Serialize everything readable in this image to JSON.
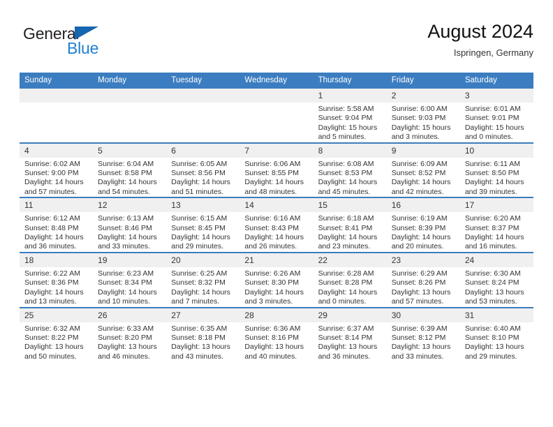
{
  "brand": {
    "name_part1": "General",
    "name_part2": "Blue",
    "triangle_color": "#1565b0",
    "blue_color": "#1f7fd0"
  },
  "header": {
    "title": "August 2024",
    "subtitle": "Ispringen, Germany"
  },
  "theme": {
    "header_bg": "#3b7dc0",
    "daynum_bg": "#f0f0f0",
    "row_divider": "#3b7dc0",
    "text": "#333333"
  },
  "weekdays": [
    "Sunday",
    "Monday",
    "Tuesday",
    "Wednesday",
    "Thursday",
    "Friday",
    "Saturday"
  ],
  "weeks": [
    [
      {
        "day": "",
        "sunrise": "",
        "sunset": "",
        "daylight1": "",
        "daylight2": ""
      },
      {
        "day": "",
        "sunrise": "",
        "sunset": "",
        "daylight1": "",
        "daylight2": ""
      },
      {
        "day": "",
        "sunrise": "",
        "sunset": "",
        "daylight1": "",
        "daylight2": ""
      },
      {
        "day": "",
        "sunrise": "",
        "sunset": "",
        "daylight1": "",
        "daylight2": ""
      },
      {
        "day": "1",
        "sunrise": "Sunrise: 5:58 AM",
        "sunset": "Sunset: 9:04 PM",
        "daylight1": "Daylight: 15 hours",
        "daylight2": "and 5 minutes."
      },
      {
        "day": "2",
        "sunrise": "Sunrise: 6:00 AM",
        "sunset": "Sunset: 9:03 PM",
        "daylight1": "Daylight: 15 hours",
        "daylight2": "and 3 minutes."
      },
      {
        "day": "3",
        "sunrise": "Sunrise: 6:01 AM",
        "sunset": "Sunset: 9:01 PM",
        "daylight1": "Daylight: 15 hours",
        "daylight2": "and 0 minutes."
      }
    ],
    [
      {
        "day": "4",
        "sunrise": "Sunrise: 6:02 AM",
        "sunset": "Sunset: 9:00 PM",
        "daylight1": "Daylight: 14 hours",
        "daylight2": "and 57 minutes."
      },
      {
        "day": "5",
        "sunrise": "Sunrise: 6:04 AM",
        "sunset": "Sunset: 8:58 PM",
        "daylight1": "Daylight: 14 hours",
        "daylight2": "and 54 minutes."
      },
      {
        "day": "6",
        "sunrise": "Sunrise: 6:05 AM",
        "sunset": "Sunset: 8:56 PM",
        "daylight1": "Daylight: 14 hours",
        "daylight2": "and 51 minutes."
      },
      {
        "day": "7",
        "sunrise": "Sunrise: 6:06 AM",
        "sunset": "Sunset: 8:55 PM",
        "daylight1": "Daylight: 14 hours",
        "daylight2": "and 48 minutes."
      },
      {
        "day": "8",
        "sunrise": "Sunrise: 6:08 AM",
        "sunset": "Sunset: 8:53 PM",
        "daylight1": "Daylight: 14 hours",
        "daylight2": "and 45 minutes."
      },
      {
        "day": "9",
        "sunrise": "Sunrise: 6:09 AM",
        "sunset": "Sunset: 8:52 PM",
        "daylight1": "Daylight: 14 hours",
        "daylight2": "and 42 minutes."
      },
      {
        "day": "10",
        "sunrise": "Sunrise: 6:11 AM",
        "sunset": "Sunset: 8:50 PM",
        "daylight1": "Daylight: 14 hours",
        "daylight2": "and 39 minutes."
      }
    ],
    [
      {
        "day": "11",
        "sunrise": "Sunrise: 6:12 AM",
        "sunset": "Sunset: 8:48 PM",
        "daylight1": "Daylight: 14 hours",
        "daylight2": "and 36 minutes."
      },
      {
        "day": "12",
        "sunrise": "Sunrise: 6:13 AM",
        "sunset": "Sunset: 8:46 PM",
        "daylight1": "Daylight: 14 hours",
        "daylight2": "and 33 minutes."
      },
      {
        "day": "13",
        "sunrise": "Sunrise: 6:15 AM",
        "sunset": "Sunset: 8:45 PM",
        "daylight1": "Daylight: 14 hours",
        "daylight2": "and 29 minutes."
      },
      {
        "day": "14",
        "sunrise": "Sunrise: 6:16 AM",
        "sunset": "Sunset: 8:43 PM",
        "daylight1": "Daylight: 14 hours",
        "daylight2": "and 26 minutes."
      },
      {
        "day": "15",
        "sunrise": "Sunrise: 6:18 AM",
        "sunset": "Sunset: 8:41 PM",
        "daylight1": "Daylight: 14 hours",
        "daylight2": "and 23 minutes."
      },
      {
        "day": "16",
        "sunrise": "Sunrise: 6:19 AM",
        "sunset": "Sunset: 8:39 PM",
        "daylight1": "Daylight: 14 hours",
        "daylight2": "and 20 minutes."
      },
      {
        "day": "17",
        "sunrise": "Sunrise: 6:20 AM",
        "sunset": "Sunset: 8:37 PM",
        "daylight1": "Daylight: 14 hours",
        "daylight2": "and 16 minutes."
      }
    ],
    [
      {
        "day": "18",
        "sunrise": "Sunrise: 6:22 AM",
        "sunset": "Sunset: 8:36 PM",
        "daylight1": "Daylight: 14 hours",
        "daylight2": "and 13 minutes."
      },
      {
        "day": "19",
        "sunrise": "Sunrise: 6:23 AM",
        "sunset": "Sunset: 8:34 PM",
        "daylight1": "Daylight: 14 hours",
        "daylight2": "and 10 minutes."
      },
      {
        "day": "20",
        "sunrise": "Sunrise: 6:25 AM",
        "sunset": "Sunset: 8:32 PM",
        "daylight1": "Daylight: 14 hours",
        "daylight2": "and 7 minutes."
      },
      {
        "day": "21",
        "sunrise": "Sunrise: 6:26 AM",
        "sunset": "Sunset: 8:30 PM",
        "daylight1": "Daylight: 14 hours",
        "daylight2": "and 3 minutes."
      },
      {
        "day": "22",
        "sunrise": "Sunrise: 6:28 AM",
        "sunset": "Sunset: 8:28 PM",
        "daylight1": "Daylight: 14 hours",
        "daylight2": "and 0 minutes."
      },
      {
        "day": "23",
        "sunrise": "Sunrise: 6:29 AM",
        "sunset": "Sunset: 8:26 PM",
        "daylight1": "Daylight: 13 hours",
        "daylight2": "and 57 minutes."
      },
      {
        "day": "24",
        "sunrise": "Sunrise: 6:30 AM",
        "sunset": "Sunset: 8:24 PM",
        "daylight1": "Daylight: 13 hours",
        "daylight2": "and 53 minutes."
      }
    ],
    [
      {
        "day": "25",
        "sunrise": "Sunrise: 6:32 AM",
        "sunset": "Sunset: 8:22 PM",
        "daylight1": "Daylight: 13 hours",
        "daylight2": "and 50 minutes."
      },
      {
        "day": "26",
        "sunrise": "Sunrise: 6:33 AM",
        "sunset": "Sunset: 8:20 PM",
        "daylight1": "Daylight: 13 hours",
        "daylight2": "and 46 minutes."
      },
      {
        "day": "27",
        "sunrise": "Sunrise: 6:35 AM",
        "sunset": "Sunset: 8:18 PM",
        "daylight1": "Daylight: 13 hours",
        "daylight2": "and 43 minutes."
      },
      {
        "day": "28",
        "sunrise": "Sunrise: 6:36 AM",
        "sunset": "Sunset: 8:16 PM",
        "daylight1": "Daylight: 13 hours",
        "daylight2": "and 40 minutes."
      },
      {
        "day": "29",
        "sunrise": "Sunrise: 6:37 AM",
        "sunset": "Sunset: 8:14 PM",
        "daylight1": "Daylight: 13 hours",
        "daylight2": "and 36 minutes."
      },
      {
        "day": "30",
        "sunrise": "Sunrise: 6:39 AM",
        "sunset": "Sunset: 8:12 PM",
        "daylight1": "Daylight: 13 hours",
        "daylight2": "and 33 minutes."
      },
      {
        "day": "31",
        "sunrise": "Sunrise: 6:40 AM",
        "sunset": "Sunset: 8:10 PM",
        "daylight1": "Daylight: 13 hours",
        "daylight2": "and 29 minutes."
      }
    ]
  ]
}
